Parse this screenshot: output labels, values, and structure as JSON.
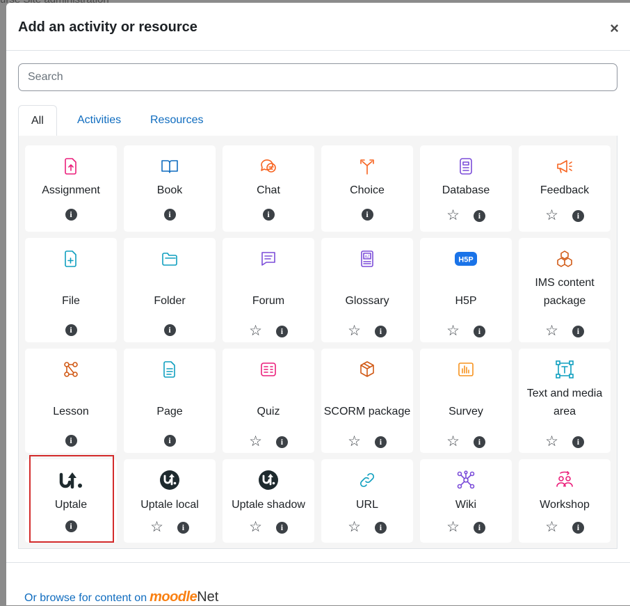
{
  "backdrop": {
    "text": "urse  Site administration"
  },
  "modal": {
    "title": "Add an activity or resource",
    "close_label": "×"
  },
  "search": {
    "placeholder": "Search",
    "value": ""
  },
  "tabs": [
    {
      "label": "All",
      "active": true
    },
    {
      "label": "Activities",
      "active": false
    },
    {
      "label": "Resources",
      "active": false
    }
  ],
  "items": [
    {
      "label": "Assignment",
      "icon": "assignment-icon",
      "color": "#eb1f7b",
      "star": false
    },
    {
      "label": "Book",
      "icon": "book-icon",
      "color": "#0f6cbf",
      "star": false
    },
    {
      "label": "Chat",
      "icon": "chat-icon",
      "color": "#f7631f",
      "star": false
    },
    {
      "label": "Choice",
      "icon": "choice-icon",
      "color": "#f7631f",
      "star": false
    },
    {
      "label": "Database",
      "icon": "database-icon",
      "color": "#7b4cd9",
      "star": true
    },
    {
      "label": "Feedback",
      "icon": "feedback-icon",
      "color": "#f7631f",
      "star": true
    },
    {
      "label": "File",
      "icon": "file-icon",
      "color": "#0f9fbf",
      "star": false
    },
    {
      "label": "Folder",
      "icon": "folder-icon",
      "color": "#0f9fbf",
      "star": false
    },
    {
      "label": "Forum",
      "icon": "forum-icon",
      "color": "#7b4cd9",
      "star": true
    },
    {
      "label": "Glossary",
      "icon": "glossary-icon",
      "color": "#7b4cd9",
      "star": true
    },
    {
      "label": "H5P",
      "icon": "h5p-icon",
      "color": "#1a73e8",
      "star": true
    },
    {
      "label": "IMS content package",
      "icon": "ims-package-icon",
      "color": "#d15a16",
      "star": true
    },
    {
      "label": "Lesson",
      "icon": "lesson-icon",
      "color": "#d15a16",
      "star": false
    },
    {
      "label": "Page",
      "icon": "page-icon",
      "color": "#0f9fbf",
      "star": false
    },
    {
      "label": "Quiz",
      "icon": "quiz-icon",
      "color": "#eb1f7b",
      "star": true
    },
    {
      "label": "SCORM package",
      "icon": "scorm-icon",
      "color": "#d15a16",
      "star": true
    },
    {
      "label": "Survey",
      "icon": "survey-icon",
      "color": "#f7931f",
      "star": true
    },
    {
      "label": "Text and media area",
      "icon": "text-media-icon",
      "color": "#0f9fbf",
      "star": true
    },
    {
      "label": "Uptale",
      "icon": "uptale-logo-icon",
      "color": "#1e2a2e",
      "star": false
    },
    {
      "label": "Uptale local",
      "icon": "uptale-circle-icon",
      "color": "#1e2a2e",
      "star": true
    },
    {
      "label": "Uptale shadow",
      "icon": "uptale-circle-icon",
      "color": "#1e2a2e",
      "star": true
    },
    {
      "label": "URL",
      "icon": "url-icon",
      "color": "#0f9fbf",
      "star": true
    },
    {
      "label": "Wiki",
      "icon": "wiki-icon",
      "color": "#7b4cd9",
      "star": true
    },
    {
      "label": "Workshop",
      "icon": "workshop-icon",
      "color": "#eb1f7b",
      "star": true
    }
  ],
  "footer": {
    "link_prefix": "Or browse for content on",
    "brand_moodle": "moodle",
    "brand_net": "Net"
  }
}
